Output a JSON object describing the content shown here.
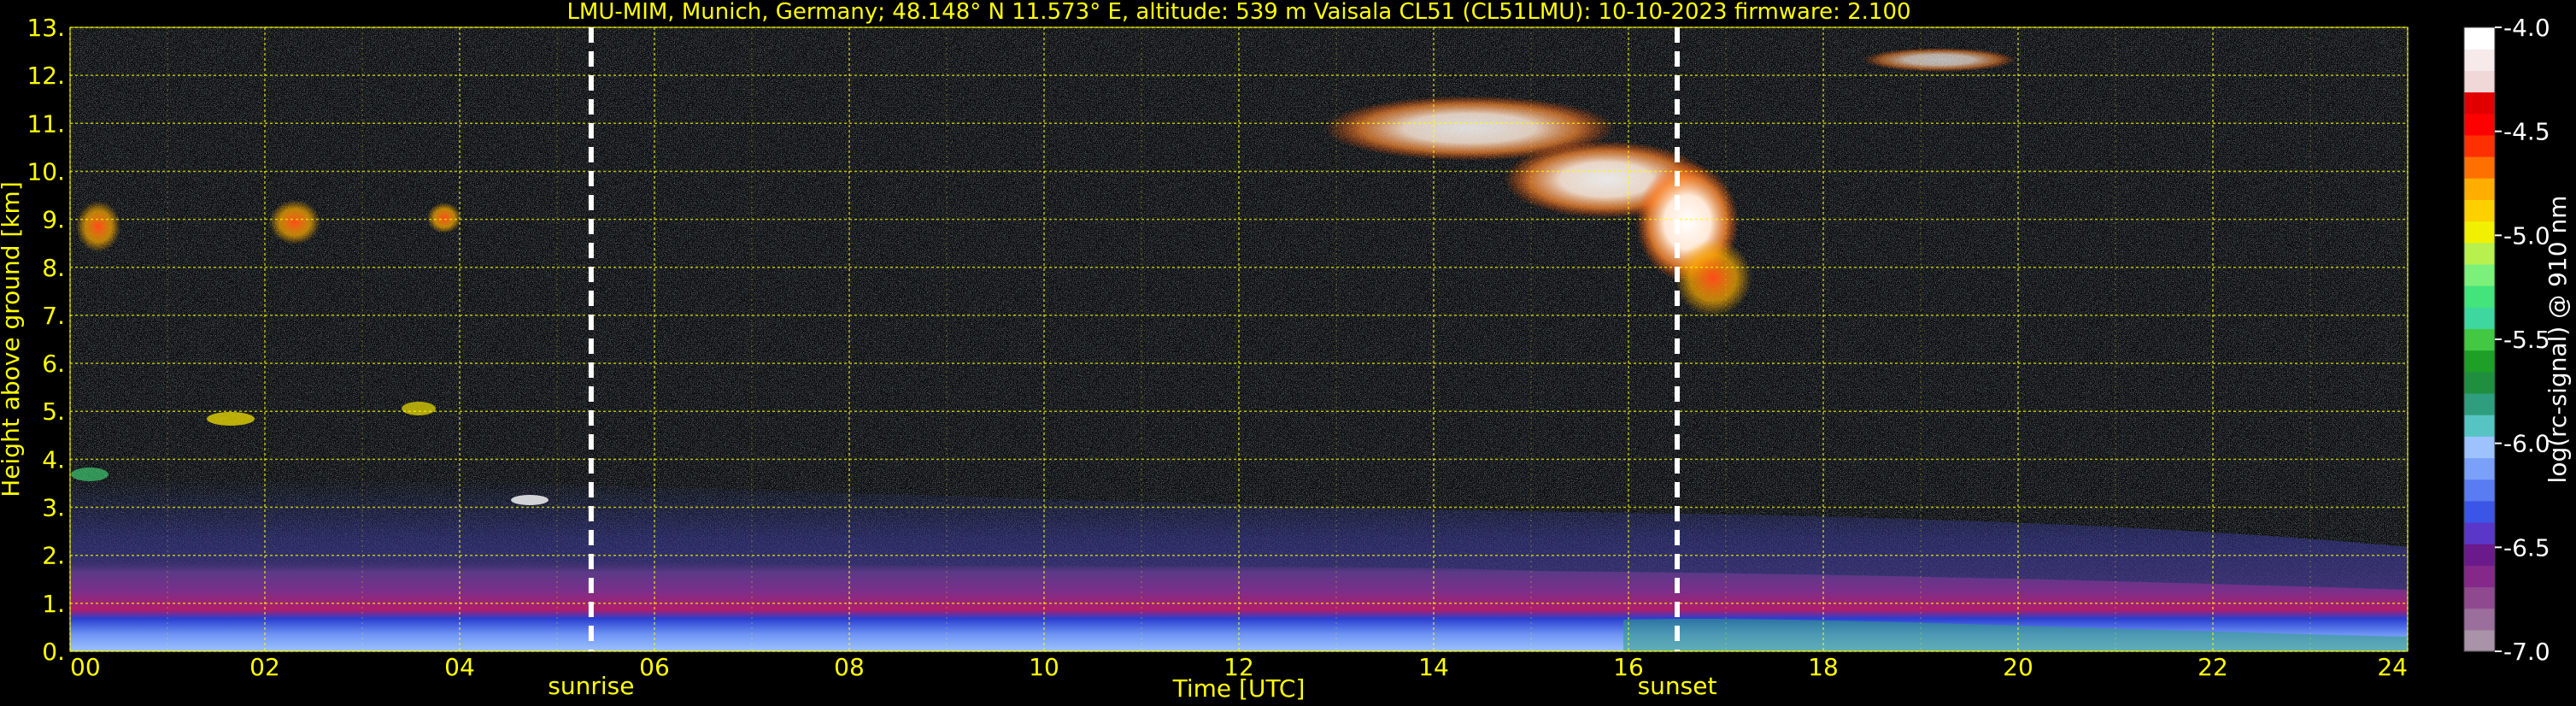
{
  "chart_data": {
    "type": "heatmap",
    "title": "LMU-MIM, Munich, Germany; 48.148° N 11.573° E, altitude: 539 m    Vaisala CL51 (CL51LMU): 10-10-2023    firmware: 2.100",
    "xlabel": "Time [UTC]",
    "ylabel": "Height above ground [km]",
    "xlim": [
      0,
      24
    ],
    "ylim": [
      0,
      13
    ],
    "x_ticks": [
      "00",
      "02",
      "04",
      "06",
      "08",
      "10",
      "12",
      "14",
      "16",
      "18",
      "20",
      "22",
      "24"
    ],
    "y_ticks": [
      "0.",
      "1.",
      "2.",
      "3.",
      "4.",
      "5.",
      "6.",
      "7.",
      "8.",
      "9.",
      "10.",
      "11.",
      "12.",
      "13."
    ],
    "grid": true,
    "annotations": [
      {
        "label": "sunrise",
        "x": 5.35
      },
      {
        "label": "sunset",
        "x": 16.5
      }
    ],
    "colorbar": {
      "label": "log(rc-signal) @ 910 nm",
      "range": [
        -7.0,
        -4.0
      ],
      "ticks": [
        "-4.0",
        "-4.5",
        "-5.0",
        "-5.5",
        "-6.0",
        "-6.5",
        "-7.0"
      ],
      "colors": [
        "#a893a8",
        "#9b6f9b",
        "#8f4a8f",
        "#84288a",
        "#6a1a8a",
        "#5a37c8",
        "#3b55e6",
        "#5a7cf2",
        "#7aa0fa",
        "#9ec2fd",
        "#57c4c4",
        "#2f9e7e",
        "#1f8f3f",
        "#1e9f28",
        "#42c842",
        "#3fd7a0",
        "#43e47b",
        "#7bf07b",
        "#b8f050",
        "#f0f000",
        "#ffd000",
        "#ffae00",
        "#ff7000",
        "#ff3000",
        "#ff0000",
        "#e00000",
        "#f0d8d8",
        "#f6eaea",
        "#ffffff"
      ]
    },
    "features": [
      {
        "kind": "boundary layer",
        "height_km": [
          0,
          1.5
        ]
      },
      {
        "kind": "residual layer",
        "height_km": [
          1,
          3
        ]
      },
      {
        "kind": "cirrus",
        "x": [
          10,
          17.5
        ],
        "height_km": [
          7,
          12.5
        ]
      },
      {
        "kind": "cirrus",
        "x": [
          0,
          4
        ],
        "height_km": [
          8,
          10.5
        ]
      }
    ]
  }
}
